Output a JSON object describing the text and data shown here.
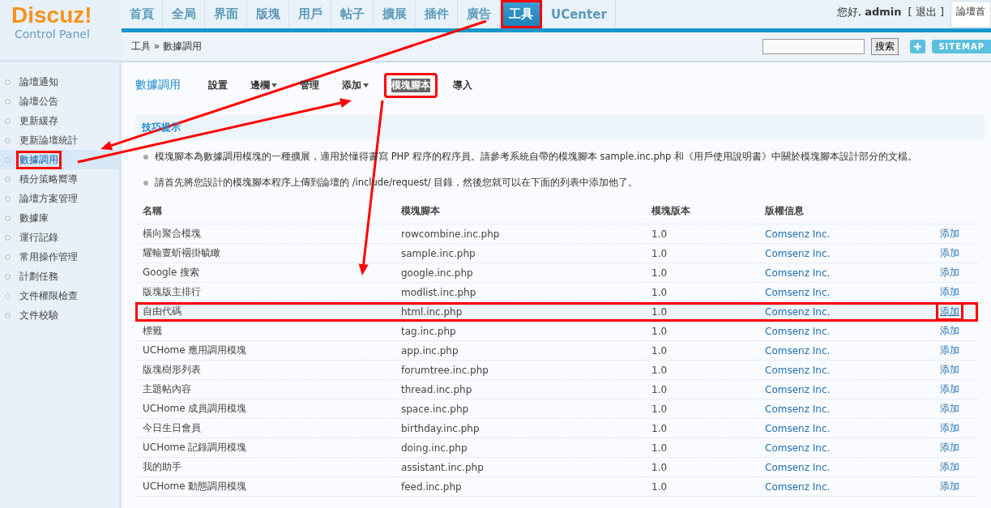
{
  "logo": {
    "title": "Discuz!",
    "subtitle": "Control Panel"
  },
  "nav": [
    {
      "label": "首頁",
      "selected": false,
      "annotated": false
    },
    {
      "label": "全局",
      "selected": false,
      "annotated": false
    },
    {
      "label": "界面",
      "selected": false,
      "annotated": false
    },
    {
      "label": "版塊",
      "selected": false,
      "annotated": false
    },
    {
      "label": "用戶",
      "selected": false,
      "annotated": false
    },
    {
      "label": "帖子",
      "selected": false,
      "annotated": false
    },
    {
      "label": "擴展",
      "selected": false,
      "annotated": false
    },
    {
      "label": "插件",
      "selected": false,
      "annotated": false
    },
    {
      "label": "廣告",
      "selected": false,
      "annotated": false
    },
    {
      "label": "工具",
      "selected": true,
      "annotated": true
    },
    {
      "label": "UCenter",
      "selected": false,
      "annotated": false
    }
  ],
  "user": {
    "greeting": "您好,",
    "name": "admin",
    "logout": "[ 退出 ]",
    "home_link": "論壇首"
  },
  "breadcrumb": "工具 » 數據調用",
  "search": {
    "button": "搜索"
  },
  "sitemap": {
    "label": "SITEMAP"
  },
  "sidebar": [
    {
      "label": "論壇通知",
      "selected": false,
      "annotated": false
    },
    {
      "label": "論壇公告",
      "selected": false,
      "annotated": false
    },
    {
      "label": "更新緩存",
      "selected": false,
      "annotated": false
    },
    {
      "label": "更新論壇統計",
      "selected": false,
      "annotated": false
    },
    {
      "label": "數據調用",
      "selected": true,
      "annotated": true
    },
    {
      "label": "積分策略嚮導",
      "selected": false,
      "annotated": false
    },
    {
      "label": "論壇方案管理",
      "selected": false,
      "annotated": false
    },
    {
      "label": "數據庫",
      "selected": false,
      "annotated": false
    },
    {
      "label": "運行記錄",
      "selected": false,
      "annotated": false
    },
    {
      "label": "常用操作管理",
      "selected": false,
      "annotated": false
    },
    {
      "label": "計劃任務",
      "selected": false,
      "annotated": false
    },
    {
      "label": "文件權限檢查",
      "selected": false,
      "annotated": false
    },
    {
      "label": "文件校驗",
      "selected": false,
      "annotated": false
    }
  ],
  "submenu": {
    "title": "數據調用",
    "items": [
      {
        "label": "設置",
        "dropdown": false,
        "selected": false,
        "annotated": false
      },
      {
        "label": "邊欄",
        "dropdown": true,
        "selected": false,
        "annotated": false
      },
      {
        "label": "管理",
        "dropdown": false,
        "selected": false,
        "annotated": false
      },
      {
        "label": "添加",
        "dropdown": true,
        "selected": false,
        "annotated": false
      },
      {
        "label": "模塊腳本",
        "dropdown": false,
        "selected": true,
        "annotated": true
      },
      {
        "label": "導入",
        "dropdown": false,
        "selected": false,
        "annotated": false
      }
    ]
  },
  "tips": {
    "title": "技巧提示",
    "items": [
      "模塊腳本為數據調用模塊的一種擴展，適用於懂得書寫 PHP 程序的程序員。請參考系統自帶的模塊腳本 sample.inc.php 和《用戶使用說明書》中關於模塊腳本設計部分的文檔。",
      "請首先將您設計的模塊腳本程序上傳到論壇的 /include/request/ 目錄，然後您就可以在下面的列表中添加他了。"
    ]
  },
  "table": {
    "columns": [
      "名稱",
      "模塊腳本",
      "模塊版本",
      "版權信息"
    ],
    "rows": [
      {
        "name": "橫向聚合模塊",
        "script": "rowcombine.inc.php",
        "version": "1.0",
        "copyright": "Comsenz Inc.",
        "action": "添加",
        "annotated": false
      },
      {
        "name": "耀輸亶蚚裀掛毓瞰",
        "script": "sample.inc.php",
        "version": "1.0",
        "copyright": "Comsenz Inc.",
        "action": "添加",
        "annotated": false
      },
      {
        "name": "Google 搜索",
        "script": "google.inc.php",
        "version": "1.0",
        "copyright": "Comsenz Inc.",
        "action": "添加",
        "annotated": false
      },
      {
        "name": "版塊版主排行",
        "script": "modlist.inc.php",
        "version": "1.0",
        "copyright": "Comsenz Inc.",
        "action": "添加",
        "annotated": false
      },
      {
        "name": "自由代碼",
        "script": "html.inc.php",
        "version": "1.0",
        "copyright": "Comsenz Inc.",
        "action": "添加",
        "annotated": true
      },
      {
        "name": "標籤",
        "script": "tag.inc.php",
        "version": "1.0",
        "copyright": "Comsenz Inc.",
        "action": "添加",
        "annotated": false
      },
      {
        "name": "UCHome 應用調用模塊",
        "script": "app.inc.php",
        "version": "1.0",
        "copyright": "Comsenz Inc.",
        "action": "添加",
        "annotated": false
      },
      {
        "name": "版塊樹形列表",
        "script": "forumtree.inc.php",
        "version": "1.0",
        "copyright": "Comsenz Inc.",
        "action": "添加",
        "annotated": false
      },
      {
        "name": "主題帖內容",
        "script": "thread.inc.php",
        "version": "1.0",
        "copyright": "Comsenz Inc.",
        "action": "添加",
        "annotated": false
      },
      {
        "name": "UCHome 成員調用模塊",
        "script": "space.inc.php",
        "version": "1.0",
        "copyright": "Comsenz Inc.",
        "action": "添加",
        "annotated": false
      },
      {
        "name": "今日生日會員",
        "script": "birthday.inc.php",
        "version": "1.0",
        "copyright": "Comsenz Inc.",
        "action": "添加",
        "annotated": false
      },
      {
        "name": "UCHome 記錄調用模塊",
        "script": "doing.inc.php",
        "version": "1.0",
        "copyright": "Comsenz Inc.",
        "action": "添加",
        "annotated": false
      },
      {
        "name": "我的助手",
        "script": "assistant.inc.php",
        "version": "1.0",
        "copyright": "Comsenz Inc.",
        "action": "添加",
        "annotated": false
      },
      {
        "name": "UCHome 動態調用模塊",
        "script": "feed.inc.php",
        "version": "1.0",
        "copyright": "Comsenz Inc.",
        "action": "添加",
        "annotated": false
      }
    ]
  },
  "annotation_arrows": true
}
